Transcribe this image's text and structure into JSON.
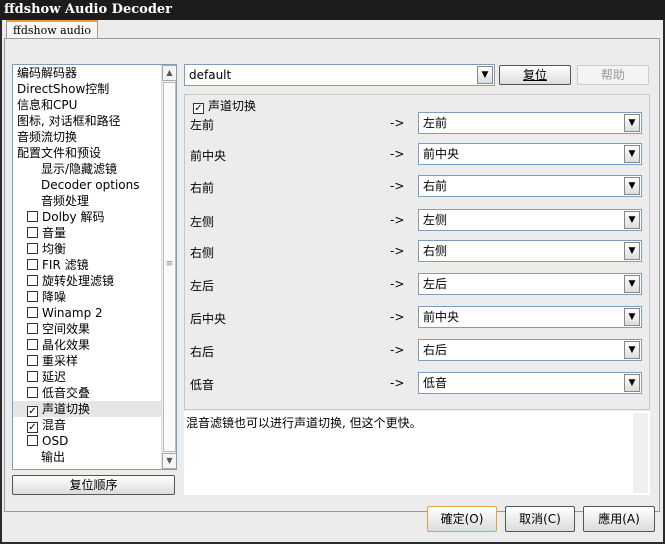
{
  "title": "ffdshow Audio Decoder",
  "tab": "ffdshow audio",
  "tree": [
    {
      "label": "编码解码器",
      "indent": 0,
      "check": null
    },
    {
      "label": "DirectShow控制",
      "indent": 0,
      "check": null
    },
    {
      "label": "信息和CPU",
      "indent": 0,
      "check": null
    },
    {
      "label": "图标, 对话框和路径",
      "indent": 0,
      "check": null
    },
    {
      "label": "音频流切换",
      "indent": 0,
      "check": null
    },
    {
      "label": "配置文件和预设",
      "indent": 0,
      "check": null
    },
    {
      "label": "显示/隐藏滤镜",
      "indent": 2,
      "check": null
    },
    {
      "label": "Decoder options",
      "indent": 2,
      "check": null
    },
    {
      "label": "音频处理",
      "indent": 2,
      "check": null
    },
    {
      "label": "Dolby 解码",
      "indent": 1,
      "check": false
    },
    {
      "label": "音量",
      "indent": 1,
      "check": false
    },
    {
      "label": "均衡",
      "indent": 1,
      "check": false
    },
    {
      "label": "FIR 滤镜",
      "indent": 1,
      "check": false
    },
    {
      "label": "旋转处理滤镜",
      "indent": 1,
      "check": false
    },
    {
      "label": "降噪",
      "indent": 1,
      "check": false
    },
    {
      "label": "Winamp 2",
      "indent": 1,
      "check": false
    },
    {
      "label": "空间效果",
      "indent": 1,
      "check": false
    },
    {
      "label": "晶化效果",
      "indent": 1,
      "check": false
    },
    {
      "label": "重采样",
      "indent": 1,
      "check": false
    },
    {
      "label": "延迟",
      "indent": 1,
      "check": false
    },
    {
      "label": "低音交叠",
      "indent": 1,
      "check": false
    },
    {
      "label": "声道切换",
      "indent": 1,
      "check": true,
      "selected": true
    },
    {
      "label": "混音",
      "indent": 1,
      "check": true
    },
    {
      "label": "OSD",
      "indent": 1,
      "check": false
    },
    {
      "label": "输出",
      "indent": 2,
      "check": null
    }
  ],
  "reset_order": "复位顺序",
  "preset": "default",
  "reset": "复位",
  "help": "帮助",
  "group_label": "声道切换",
  "group_checked": true,
  "arrow": "->",
  "rows": [
    {
      "src": "左前",
      "dst": "左前"
    },
    {
      "src": "前中央",
      "dst": "前中央"
    },
    {
      "src": "右前",
      "dst": "右前"
    },
    {
      "src": "左侧",
      "dst": "左侧"
    },
    {
      "src": "右侧",
      "dst": "右侧"
    },
    {
      "src": "左后",
      "dst": "左后"
    },
    {
      "src": "后中央",
      "dst": "前中央"
    },
    {
      "src": "右后",
      "dst": "右后"
    },
    {
      "src": "低音",
      "dst": "低音"
    }
  ],
  "description": "混音滤镜也可以进行声道切换, 但这个更快。",
  "ok": "確定(O)",
  "cancel": "取消(C)",
  "apply": "應用(A)"
}
